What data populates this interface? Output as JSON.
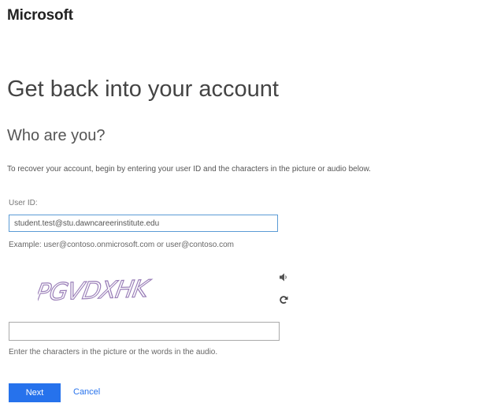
{
  "brand": {
    "name": "Microsoft"
  },
  "page": {
    "title": "Get back into your account",
    "subtitle": "Who are you?",
    "instructions": "To recover your account, begin by entering your user ID and the characters in the picture or audio below."
  },
  "user_id": {
    "label": "User ID:",
    "value": "student.test@stu.dawncareerinstitute.edu",
    "example": "Example: user@contoso.onmicrosoft.com or user@contoso.com"
  },
  "captcha": {
    "text": "PGVDXHK",
    "audio_icon": "speaker-icon",
    "refresh_icon": "refresh-icon",
    "input_value": "",
    "hint": "Enter the characters in the picture or the words in the audio."
  },
  "actions": {
    "next_label": "Next",
    "cancel_label": "Cancel"
  },
  "colors": {
    "accent": "#2672ec",
    "input_focus_border": "#5b9bd5",
    "captcha_text": "#9a7fb8"
  }
}
